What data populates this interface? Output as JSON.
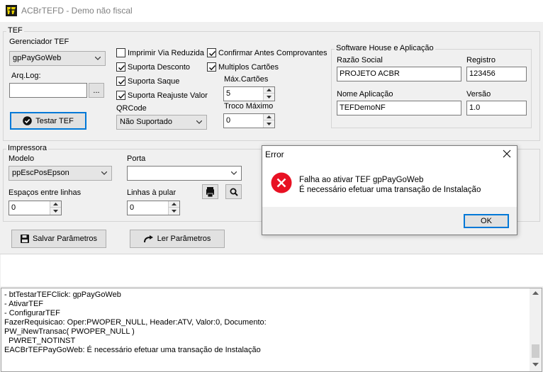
{
  "window": {
    "title": "ACBrTEFD - Demo não fiscal"
  },
  "tef": {
    "group_title": "TEF",
    "gerenciador_label": "Gerenciador TEF",
    "gerenciador_value": "gpPayGoWeb",
    "arqlog_label": "Arq.Log:",
    "arqlog_value": "",
    "browse_label": "...",
    "testar_label": "Testar TEF",
    "options": [
      {
        "label": "Imprimir Via Reduzida",
        "checked": false
      },
      {
        "label": "Suporta Desconto",
        "checked": true
      },
      {
        "label": "Suporta Saque",
        "checked": true
      },
      {
        "label": "Suporta Reajuste Valor",
        "checked": true
      },
      {
        "label": "Confirmar Antes Comprovantes",
        "checked": true
      },
      {
        "label": "Multiplos Cartões",
        "checked": true
      }
    ],
    "qrcode_label": "QRCode",
    "qrcode_value": "Não Suportado",
    "max_cartoes_label": "Máx.Cartões",
    "max_cartoes_value": "5",
    "troco_label": "Troco Máximo",
    "troco_value": "0"
  },
  "software_house": {
    "group_title": "Software House e Aplicação",
    "razao_label": "Razão Social",
    "razao_value": "PROJETO ACBR",
    "registro_label": "Registro",
    "registro_value": "123456",
    "nome_label": "Nome Aplicação",
    "nome_value": "TEFDemoNF",
    "versao_label": "Versão",
    "versao_value": "1.0"
  },
  "impressora": {
    "group_title": "Impressora",
    "modelo_label": "Modelo",
    "modelo_value": "ppEscPosEpson",
    "porta_label": "Porta",
    "porta_value": "",
    "espacos_label": "Espaços entre linhas",
    "espacos_value": "0",
    "linhas_label": "Linhas à pular",
    "linhas_value": "0"
  },
  "actions": {
    "salvar_label": "Salvar Parâmetros",
    "ler_label": "Ler Parâmetros"
  },
  "log": {
    "lines": [
      "- btTestarTEFClick: gpPayGoWeb",
      "- AtivarTEF",
      "- ConfigurarTEF",
      "FazerRequisicao: Oper:PWOPER_NULL, Header:ATV, Valor:0, Documento:",
      "PW_iNewTransac( PWOPER_NULL )",
      "  PWRET_NOTINST",
      "EACBrTEFPayGoWeb: É necessário efetuar uma transação de Instalação"
    ]
  },
  "dialog": {
    "title": "Error",
    "line1": "Falha ao ativar TEF gpPayGoWeb",
    "line2": "É necessário efetuar uma transação de Instalação",
    "ok_label": "OK"
  },
  "colors": {
    "accent": "#0078d7",
    "error": "#e81123"
  }
}
